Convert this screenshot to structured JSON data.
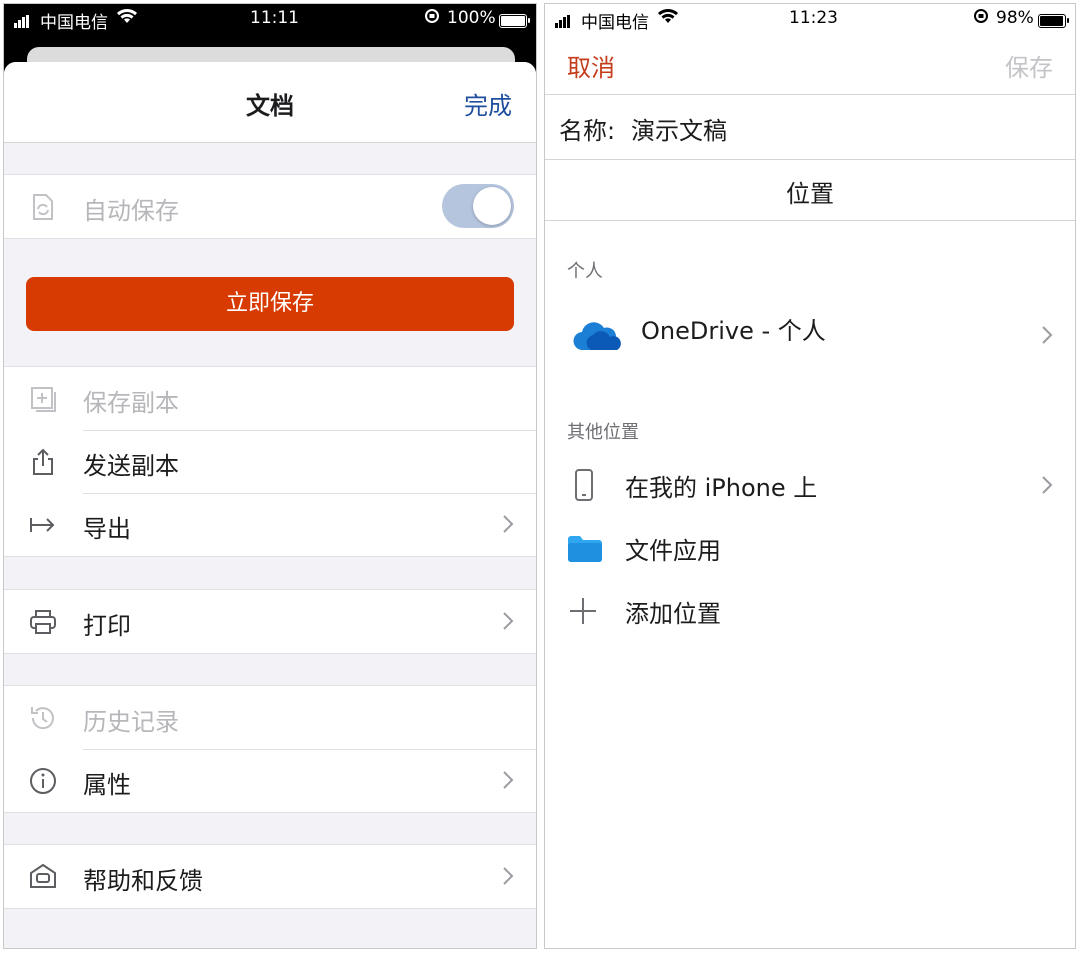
{
  "left": {
    "status": {
      "carrier": "中国电信",
      "time": "11:11",
      "battery": "100%"
    },
    "sheet": {
      "title": "文档",
      "done": "完成",
      "autosave": {
        "label": "自动保存",
        "on": true
      },
      "save_now": "立即保存",
      "rows_a": [
        {
          "label": "保存副本",
          "icon": "save-copy-icon",
          "dim": true,
          "chevron": false
        },
        {
          "label": "发送副本",
          "icon": "share-icon",
          "dim": false,
          "chevron": false
        },
        {
          "label": "导出",
          "icon": "export-icon",
          "dim": false,
          "chevron": true
        }
      ],
      "print": "打印",
      "history": "历史记录",
      "properties": "属性",
      "help": "帮助和反馈"
    }
  },
  "right": {
    "status": {
      "carrier": "中国电信",
      "time": "11:23",
      "battery": "98%"
    },
    "nav": {
      "cancel": "取消",
      "save": "保存"
    },
    "name_label": "名称:",
    "name_value": "演示文稿",
    "location_title": "位置",
    "personal_header": "个人",
    "onedrive": "OneDrive - 个人",
    "other_header": "其他位置",
    "iphone": "在我的 iPhone 上",
    "files_app": "文件应用",
    "add_location": "添加位置"
  },
  "colors": {
    "accent_orange": "#d83b01",
    "link_blue": "#1f4e9e",
    "cancel_red": "#c43e1c",
    "onedrive_blue": "#1c7fd6",
    "folder_blue": "#2ea7f0"
  }
}
